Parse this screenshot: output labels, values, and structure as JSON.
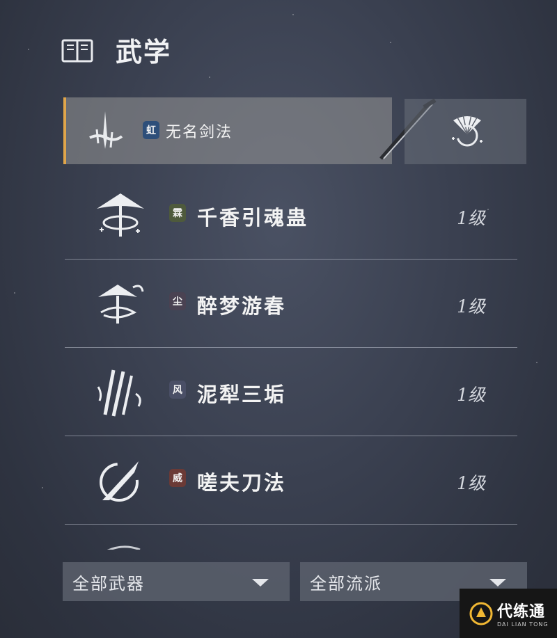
{
  "header": {
    "title": "武学",
    "icon": "book-icon"
  },
  "equipped": {
    "badge": "虹",
    "badge_color": "#2e4f7a",
    "name": "无名剑法",
    "accent": "#e0a54a",
    "icon": "sword-stroke-icon",
    "weapon_icon": "sword-icon",
    "side_icon": "fan-icon"
  },
  "skills": [
    {
      "badge": "霖",
      "badge_color": "#4e5a3c",
      "name": "千香引魂蛊",
      "level": "1级",
      "icon": "umbrella-spiral-icon"
    },
    {
      "badge": "尘",
      "badge_color": "#4a4252",
      "name": "醉梦游春",
      "level": "1级",
      "icon": "umbrella-swirl-icon"
    },
    {
      "badge": "风",
      "badge_color": "#4a4f66",
      "name": "泥犁三垢",
      "level": "1级",
      "icon": "claw-slash-icon"
    },
    {
      "badge": "威",
      "badge_color": "#6b3a36",
      "name": "嗟夫刀法",
      "level": "1级",
      "icon": "blade-circle-icon"
    }
  ],
  "filters": {
    "weapon": "全部武器",
    "school": "全部流派"
  },
  "watermark": {
    "main": "代练通",
    "sub": "DAI LIAN TONG"
  }
}
